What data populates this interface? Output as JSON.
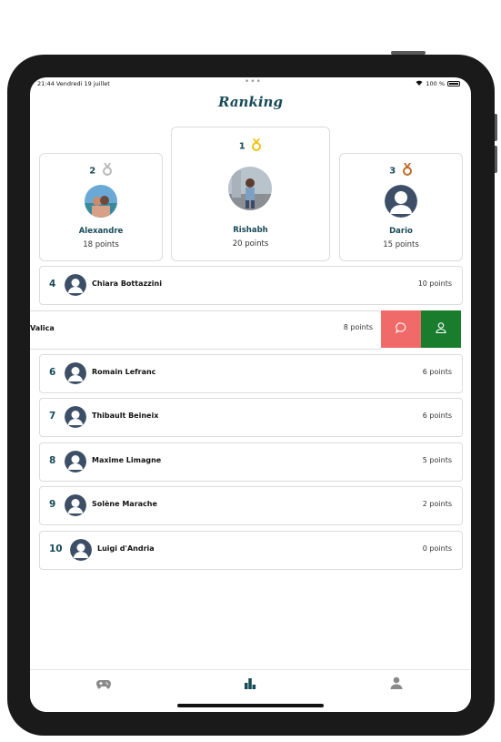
{
  "status": {
    "time": "21:44",
    "date": "Vendredi 19 juillet",
    "dots": "•••",
    "battery": "100 %"
  },
  "title": "Ranking",
  "podium": [
    {
      "rank": "2",
      "medal": "silver",
      "name": "Alexandre",
      "points": "18 points"
    },
    {
      "rank": "1",
      "medal": "gold",
      "name": "Rishabh",
      "points": "20 points"
    },
    {
      "rank": "3",
      "medal": "bronze",
      "name": "Dario",
      "points": "15 points"
    }
  ],
  "list": [
    {
      "rank": "4",
      "name": "Chiara Bottazzini",
      "points": "10 points"
    },
    {
      "rank": "",
      "name": "Valica",
      "points": "8 points"
    },
    {
      "rank": "6",
      "name": "Romain Lefranc",
      "points": "6 points"
    },
    {
      "rank": "7",
      "name": "Thibault Beineix",
      "points": "6 points"
    },
    {
      "rank": "8",
      "name": "Maxime Limagne",
      "points": "5 points"
    },
    {
      "rank": "9",
      "name": "Solène Marache",
      "points": "2 points"
    },
    {
      "rank": "10",
      "name": "Luigi d'Andria",
      "points": "0 points"
    }
  ],
  "colors": {
    "accent": "#184a58",
    "gold": "#f2c218",
    "silver": "#b8b8b8",
    "bronze": "#c26a2b",
    "swipe_red": "#f06a6a",
    "swipe_green": "#1a7d2e"
  },
  "tabs": [
    {
      "icon": "gamepad-icon"
    },
    {
      "icon": "ranking-bars-icon",
      "active": true
    },
    {
      "icon": "profile-icon"
    }
  ]
}
